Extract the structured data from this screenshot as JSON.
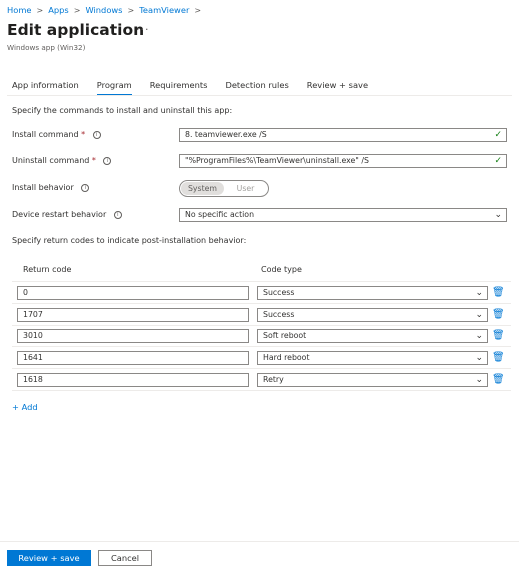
{
  "breadcrumb": [
    "Home",
    "Apps",
    "Windows",
    "TeamViewer"
  ],
  "page": {
    "title": "Edit application",
    "more": "···",
    "subtitle": "Windows app (Win32)"
  },
  "tabs": [
    "App information",
    "Program",
    "Requirements",
    "Detection rules",
    "Review + save"
  ],
  "active_tab": "Program",
  "program": {
    "intro": "Specify the commands to install and uninstall this app:",
    "install_command_label": "Install command",
    "install_command_value": "8. teamviewer.exe /S",
    "uninstall_command_label": "Uninstall command",
    "uninstall_command_value": "\"%ProgramFiles%\\TeamViewer\\uninstall.exe\" /S",
    "install_behavior_label": "Install behavior",
    "install_behavior_options": [
      "System",
      "User"
    ],
    "install_behavior_selected": "System",
    "restart_label": "Device restart behavior",
    "restart_value": "No specific action",
    "required_mark": "*",
    "info_glyph": "i"
  },
  "return_codes": {
    "intro": "Specify return codes to indicate post-installation behavior:",
    "col_code": "Return code",
    "col_type": "Code type",
    "rows": [
      {
        "code": "0",
        "type": "Success"
      },
      {
        "code": "1707",
        "type": "Success"
      },
      {
        "code": "3010",
        "type": "Soft reboot"
      },
      {
        "code": "1641",
        "type": "Hard reboot"
      },
      {
        "code": "1618",
        "type": "Retry"
      }
    ],
    "add_label": "+ Add"
  },
  "footer": {
    "primary_label": "Review + save",
    "secondary_label": "Cancel"
  },
  "colors": {
    "accent": "#0078d4",
    "valid": "#107c10",
    "required": "#a4262c"
  },
  "icons": {
    "breadcrumb_separator": "chevron-right-icon",
    "valid": "checkmark-icon",
    "dropdown": "chevron-down-icon",
    "delete": "trash-icon",
    "info": "info-icon"
  }
}
